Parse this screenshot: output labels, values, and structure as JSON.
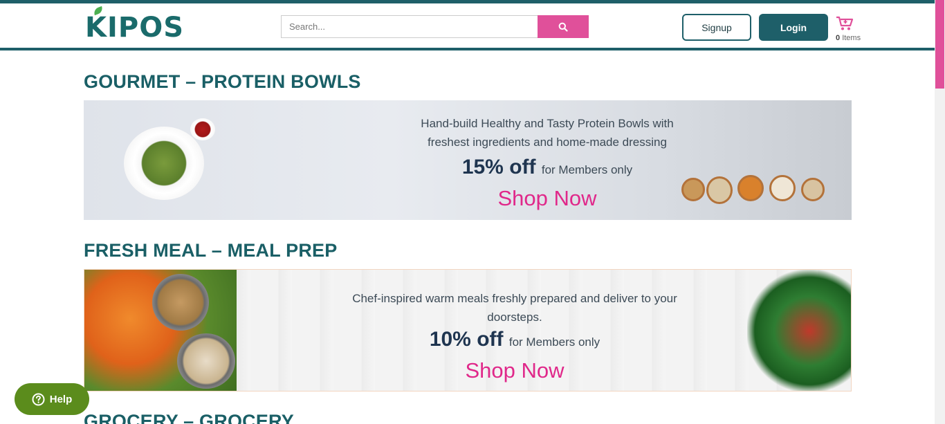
{
  "header": {
    "logo_text": "KIPOS",
    "search": {
      "placeholder": "Search..."
    },
    "signup_label": "Signup",
    "login_label": "Login",
    "cart": {
      "count": "0",
      "label": "Items"
    }
  },
  "sections": [
    {
      "title": "GOURMET – PROTEIN BOWLS",
      "banner": {
        "line1": "Hand-build Healthy and Tasty Protein Bowls with",
        "line2": "freshest ingredients and home-made dressing",
        "offer": "15% off",
        "offer_note": "for Members only",
        "cta": "Shop Now"
      }
    },
    {
      "title": "FRESH MEAL – MEAL PREP",
      "banner": {
        "line1": "Chef-inspired warm meals freshly prepared and deliver to your",
        "line2": "doorsteps.",
        "offer": "10% off",
        "offer_note": "for Members only",
        "cta": "Shop Now"
      }
    },
    {
      "title": "GROCERY – GROCERY"
    }
  ],
  "help": {
    "label": "Help"
  },
  "colors": {
    "primary": "#1e5f69",
    "accent": "#e0509a",
    "help": "#5b8c1c"
  }
}
